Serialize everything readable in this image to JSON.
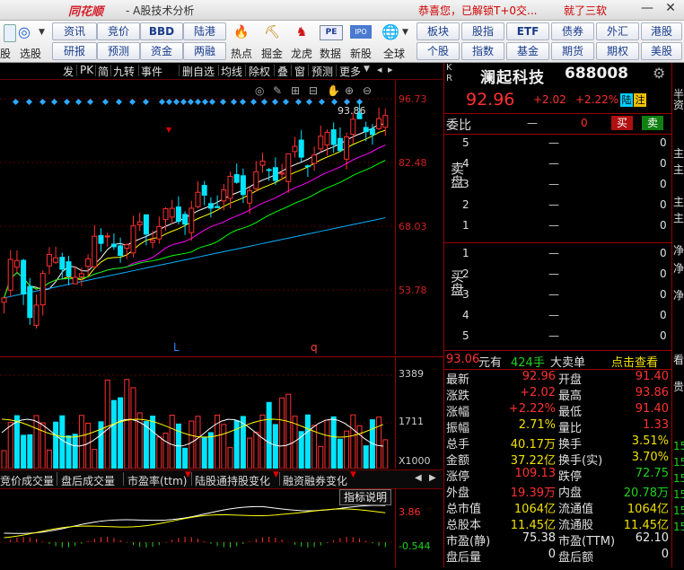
{
  "titlebar": {
    "logo": "同花顺",
    "title": "- A股技术分析",
    "promo": "恭喜您，已解锁T+0交...",
    "promo2": "就了三软",
    "min": "—",
    "close": "✕"
  },
  "toolbar": {
    "left_label": "股",
    "xuangu": "选股",
    "xuangu_icon": "magnify-chart-icon",
    "row1": [
      "资讯",
      "竞价",
      "BBD",
      "陆港"
    ],
    "row2": [
      "研报",
      "预测",
      "资金",
      "两融"
    ],
    "icons": [
      {
        "label": "热点",
        "icon": "hot-icon"
      },
      {
        "label": "掘金",
        "icon": "gold-icon"
      },
      {
        "label": "龙虎",
        "icon": "dragon-icon"
      },
      {
        "label": "数据",
        "icon": "pe-icon"
      },
      {
        "label": "新股",
        "icon": "ipo-icon"
      },
      {
        "label": "全球",
        "icon": "globe-icon"
      }
    ],
    "pe_text": "PE",
    "ipo_text": "IPO",
    "right_row1": [
      "板块",
      "股指",
      "ETF",
      "债券",
      "外汇",
      "港股"
    ],
    "right_row2": [
      "个股",
      "指数",
      "基金",
      "期货",
      "期权",
      "美股"
    ]
  },
  "menu_strip": [
    "发",
    "PK",
    "简",
    "九转",
    "事件",
    "删自选",
    "均线",
    "除权",
    "叠",
    "窗",
    "预测",
    "更多"
  ],
  "chart": {
    "price_ticks": [
      "96.73",
      "82.48",
      "68.03",
      "53.78"
    ],
    "high_label": "93.86",
    "markers": [
      "L",
      "q"
    ],
    "vol_ticks": [
      "3389",
      "1711",
      "X1000"
    ],
    "ind_ticks": [
      "3.86",
      "-0.544"
    ],
    "ind_tabs": [
      "竞价成交量",
      "盘后成交量",
      "市盈率(ttm)",
      "陆股通持股变化",
      "融资融券变化"
    ],
    "explain_label": "指标说明",
    "colors": {
      "up": "#ff3030",
      "down": "#00e5ff",
      "ma5": "#ffffff",
      "ma10": "#ffff00",
      "ma20": "#ff00ff",
      "ma30": "#00ff00",
      "ma60": "#00b0ff"
    }
  },
  "quote": {
    "kr": [
      "K",
      "R"
    ],
    "name": "澜起科技",
    "code": "688008",
    "price": "92.96",
    "chg": "+2.02",
    "chgp": "+2.22%",
    "badge1": "陆",
    "badge2": "注",
    "weibi_label": "委比",
    "weibi_val": "—",
    "weibi_num": "0",
    "buy_label": "买",
    "sell_label": "卖",
    "sell_side": "卖盘",
    "buy_side": "买盘",
    "sell_levels": [
      "5",
      "4",
      "3",
      "2",
      "1"
    ],
    "buy_levels": [
      "1",
      "2",
      "3",
      "4",
      "5"
    ],
    "dash": "—",
    "zero": "0",
    "ticker": {
      "price": "93.06",
      "unit": "元有",
      "vol": "424手",
      "type": "大卖单",
      "link": "点击查看"
    },
    "stats": [
      {
        "l": "最新",
        "v": "92.96",
        "vc": "red",
        "l2": "开盘",
        "v2": "91.40",
        "v2c": "red"
      },
      {
        "l": "涨跌",
        "v": "+2.02",
        "vc": "red",
        "l2": "最高",
        "v2": "93.86",
        "v2c": "red"
      },
      {
        "l": "涨幅",
        "v": "+2.22%",
        "vc": "red",
        "l2": "最低",
        "v2": "91.40",
        "v2c": "red"
      },
      {
        "l": "振幅",
        "v": "2.71%",
        "vc": "yellow",
        "l2": "量比",
        "v2": "1.33",
        "v2c": "red"
      },
      {
        "l": "总手",
        "v": "40.17万",
        "vc": "yellow",
        "l2": "换手",
        "v2": "3.51%",
        "v2c": "yellow"
      },
      {
        "l": "金额",
        "v": "37.22亿",
        "vc": "yellow",
        "l2": "换手(实)",
        "v2": "3.70%",
        "v2c": "yellow"
      },
      {
        "l": "涨停",
        "v": "109.13",
        "vc": "red",
        "l2": "跌停",
        "v2": "72.75",
        "v2c": "green"
      },
      {
        "l": "外盘",
        "v": "19.39万",
        "vc": "red",
        "l2": "内盘",
        "v2": "20.78万",
        "v2c": "green"
      },
      {
        "l": "总市值",
        "v": "1064亿",
        "vc": "yellow",
        "l2": "流通值",
        "v2": "1064亿",
        "v2c": "yellow"
      },
      {
        "l": "总股本",
        "v": "11.45亿",
        "vc": "yellow",
        "l2": "流通股",
        "v2": "11.45亿",
        "v2c": "yellow"
      },
      {
        "l": "市盈(静)",
        "v": "75.38",
        "vc": "white",
        "l2": "市盈(TTM)",
        "v2": "62.10",
        "v2c": "white"
      },
      {
        "l": "盘后量",
        "v": "0",
        "vc": "white",
        "l2": "盘后额",
        "v2": "0",
        "v2c": "white"
      }
    ]
  },
  "rpanel": [
    "半",
    "资",
    "主",
    "主",
    "主",
    "主",
    "净",
    "净",
    "净",
    "净",
    "看",
    "贵",
    "15",
    "15",
    "15",
    "15",
    "15",
    "15"
  ]
}
